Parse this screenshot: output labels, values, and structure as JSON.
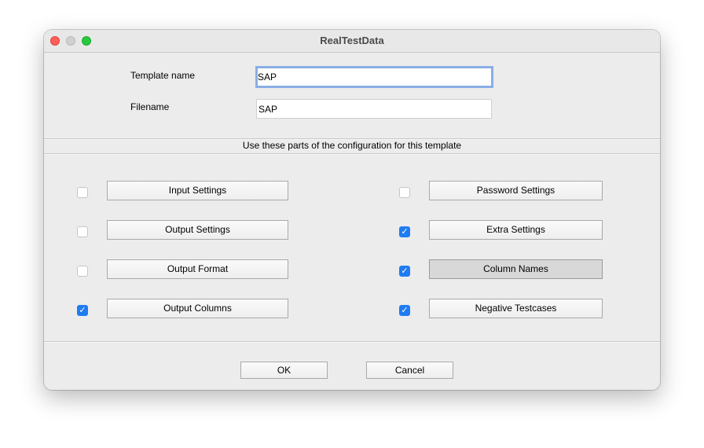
{
  "window": {
    "title": "RealTestData"
  },
  "form": {
    "template_name_label": "Template name",
    "template_name_value": "SAP",
    "filename_label": "Filename",
    "filename_value": "SAP"
  },
  "section": {
    "title": "Use these parts of the configuration for this template"
  },
  "options": [
    {
      "label": "Input Settings",
      "checked": false
    },
    {
      "label": "Output Settings",
      "checked": false
    },
    {
      "label": "Output Format",
      "checked": false
    },
    {
      "label": "Output Columns",
      "checked": true
    },
    {
      "label": "Password Settings",
      "checked": false
    },
    {
      "label": "Extra Settings",
      "checked": true
    },
    {
      "label": "Column Names",
      "checked": true
    },
    {
      "label": "Negative Testcases",
      "checked": true
    }
  ],
  "footer": {
    "ok_label": "OK",
    "cancel_label": "Cancel"
  },
  "colors": {
    "accent": "#1f7cf2",
    "focus_ring": "#8aaee6",
    "close": "#ff5f57",
    "maximize": "#28c840"
  }
}
